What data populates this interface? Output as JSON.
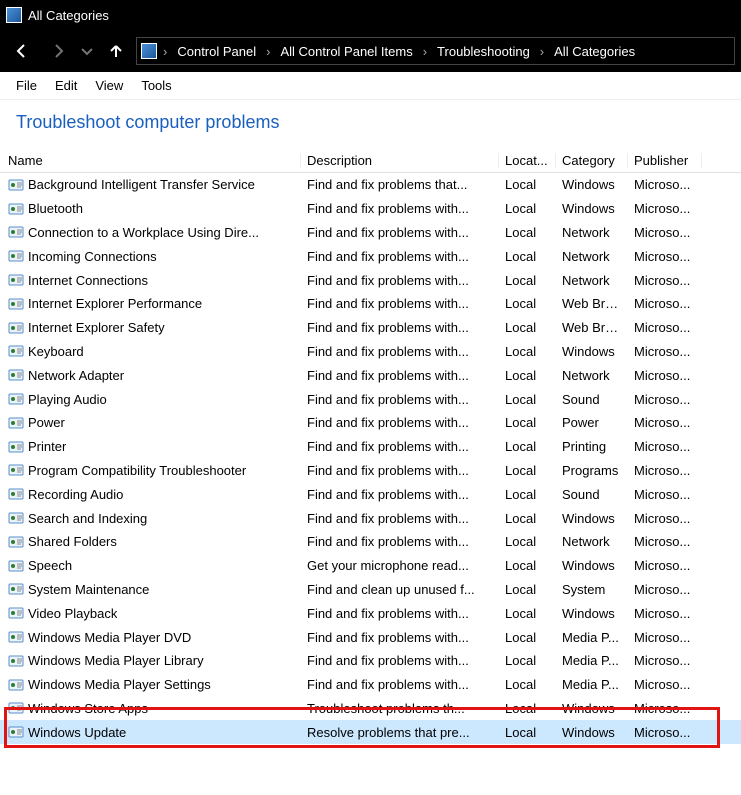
{
  "title": "All Categories",
  "breadcrumb": [
    "Control Panel",
    "All Control Panel Items",
    "Troubleshooting",
    "All Categories"
  ],
  "menu": [
    "File",
    "Edit",
    "View",
    "Tools"
  ],
  "heading": "Troubleshoot computer problems",
  "columns": {
    "name": "Name",
    "desc": "Description",
    "loc": "Locat...",
    "cat": "Category",
    "pub": "Publisher"
  },
  "rows": [
    {
      "name": "Background Intelligent Transfer Service",
      "desc": "Find and fix problems that...",
      "loc": "Local",
      "cat": "Windows",
      "pub": "Microso..."
    },
    {
      "name": "Bluetooth",
      "desc": "Find and fix problems with...",
      "loc": "Local",
      "cat": "Windows",
      "pub": "Microso..."
    },
    {
      "name": "Connection to a Workplace Using Dire...",
      "desc": "Find and fix problems with...",
      "loc": "Local",
      "cat": "Network",
      "pub": "Microso..."
    },
    {
      "name": "Incoming Connections",
      "desc": "Find and fix problems with...",
      "loc": "Local",
      "cat": "Network",
      "pub": "Microso..."
    },
    {
      "name": "Internet Connections",
      "desc": "Find and fix problems with...",
      "loc": "Local",
      "cat": "Network",
      "pub": "Microso..."
    },
    {
      "name": "Internet Explorer Performance",
      "desc": "Find and fix problems with...",
      "loc": "Local",
      "cat": "Web Bro...",
      "pub": "Microso..."
    },
    {
      "name": "Internet Explorer Safety",
      "desc": "Find and fix problems with...",
      "loc": "Local",
      "cat": "Web Bro...",
      "pub": "Microso..."
    },
    {
      "name": "Keyboard",
      "desc": "Find and fix problems with...",
      "loc": "Local",
      "cat": "Windows",
      "pub": "Microso..."
    },
    {
      "name": "Network Adapter",
      "desc": "Find and fix problems with...",
      "loc": "Local",
      "cat": "Network",
      "pub": "Microso..."
    },
    {
      "name": "Playing Audio",
      "desc": "Find and fix problems with...",
      "loc": "Local",
      "cat": "Sound",
      "pub": "Microso..."
    },
    {
      "name": "Power",
      "desc": "Find and fix problems with...",
      "loc": "Local",
      "cat": "Power",
      "pub": "Microso..."
    },
    {
      "name": "Printer",
      "desc": "Find and fix problems with...",
      "loc": "Local",
      "cat": "Printing",
      "pub": "Microso..."
    },
    {
      "name": "Program Compatibility Troubleshooter",
      "desc": "Find and fix problems with...",
      "loc": "Local",
      "cat": "Programs",
      "pub": "Microso..."
    },
    {
      "name": "Recording Audio",
      "desc": "Find and fix problems with...",
      "loc": "Local",
      "cat": "Sound",
      "pub": "Microso..."
    },
    {
      "name": "Search and Indexing",
      "desc": "Find and fix problems with...",
      "loc": "Local",
      "cat": "Windows",
      "pub": "Microso..."
    },
    {
      "name": "Shared Folders",
      "desc": "Find and fix problems with...",
      "loc": "Local",
      "cat": "Network",
      "pub": "Microso..."
    },
    {
      "name": "Speech",
      "desc": "Get your microphone read...",
      "loc": "Local",
      "cat": "Windows",
      "pub": "Microso..."
    },
    {
      "name": "System Maintenance",
      "desc": "Find and clean up unused f...",
      "loc": "Local",
      "cat": "System",
      "pub": "Microso..."
    },
    {
      "name": "Video Playback",
      "desc": "Find and fix problems with...",
      "loc": "Local",
      "cat": "Windows",
      "pub": "Microso..."
    },
    {
      "name": "Windows Media Player DVD",
      "desc": "Find and fix problems with...",
      "loc": "Local",
      "cat": "Media P...",
      "pub": "Microso..."
    },
    {
      "name": "Windows Media Player Library",
      "desc": "Find and fix problems with...",
      "loc": "Local",
      "cat": "Media P...",
      "pub": "Microso..."
    },
    {
      "name": "Windows Media Player Settings",
      "desc": "Find and fix problems with...",
      "loc": "Local",
      "cat": "Media P...",
      "pub": "Microso..."
    },
    {
      "name": "Windows Store Apps",
      "desc": "Troubleshoot problems th...",
      "loc": "Local",
      "cat": "Windows",
      "pub": "Microso..."
    },
    {
      "name": "Windows Update",
      "desc": "Resolve problems that pre...",
      "loc": "Local",
      "cat": "Windows",
      "pub": "Microso...",
      "selected": true
    }
  ]
}
